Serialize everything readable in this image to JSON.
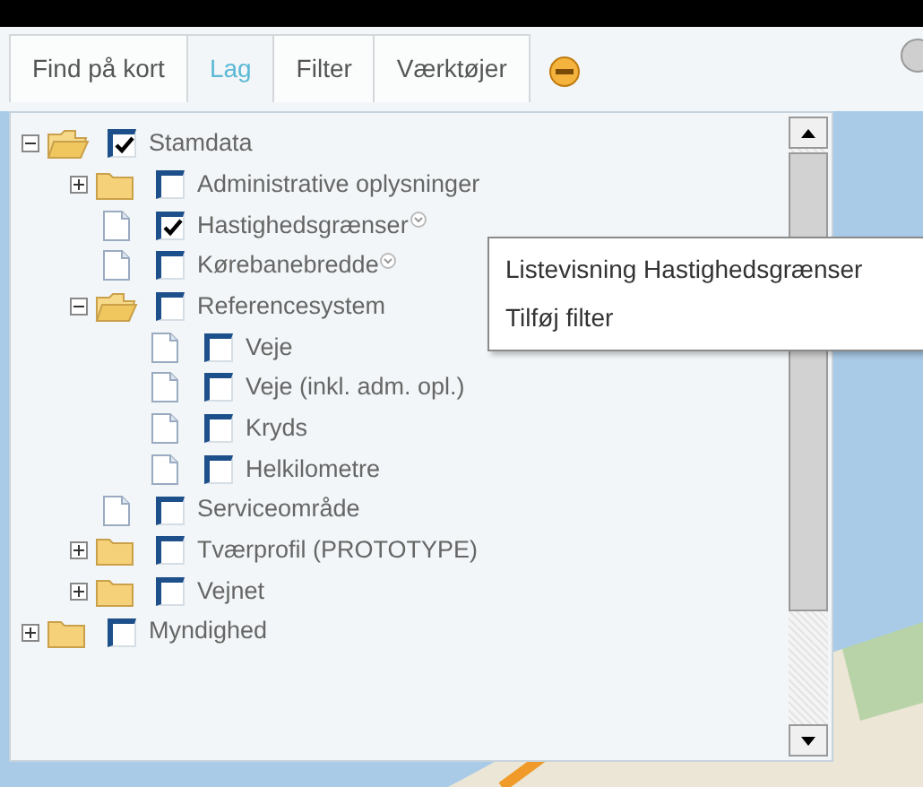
{
  "tabs": [
    {
      "label": "Find på kort",
      "selected": false
    },
    {
      "label": "Lag",
      "selected": true
    },
    {
      "label": "Filter",
      "selected": false
    },
    {
      "label": "Værktøjer",
      "selected": false
    }
  ],
  "layer_tree": [
    {
      "label": "Stamdata",
      "kind": "folder",
      "expanded": true,
      "checked": true,
      "menu_icon": false,
      "children": [
        {
          "label": "Administrative oplysninger",
          "kind": "folder",
          "expanded": false,
          "checked": false,
          "menu_icon": false
        },
        {
          "label": "Hastighedsgrænser",
          "kind": "layer",
          "checked": true,
          "menu_icon": true
        },
        {
          "label": "Kørebanebredde",
          "kind": "layer",
          "checked": false,
          "menu_icon": true
        },
        {
          "label": "Referencesystem",
          "kind": "folder",
          "expanded": true,
          "checked": false,
          "menu_icon": false,
          "children": [
            {
              "label": "Veje",
              "kind": "layer",
              "checked": false,
              "menu_icon": false
            },
            {
              "label": "Veje (inkl. adm. opl.)",
              "kind": "layer",
              "checked": false,
              "menu_icon": false
            },
            {
              "label": "Kryds",
              "kind": "layer",
              "checked": false,
              "menu_icon": false
            },
            {
              "label": "Helkilometre",
              "kind": "layer",
              "checked": false,
              "menu_icon": false
            }
          ]
        },
        {
          "label": "Serviceområde",
          "kind": "layer",
          "checked": false,
          "menu_icon": false
        },
        {
          "label": "Tværprofil (PROTOTYPE)",
          "kind": "folder",
          "expanded": false,
          "checked": false,
          "menu_icon": false
        },
        {
          "label": "Vejnet",
          "kind": "folder",
          "expanded": false,
          "checked": false,
          "menu_icon": false
        }
      ]
    },
    {
      "label": "Myndighed",
      "kind": "folder",
      "expanded": false,
      "checked": false,
      "menu_icon": false
    }
  ],
  "context_menu": {
    "items": [
      "Listevisning Hastighedsgrænser",
      "Tilføj filter"
    ]
  }
}
